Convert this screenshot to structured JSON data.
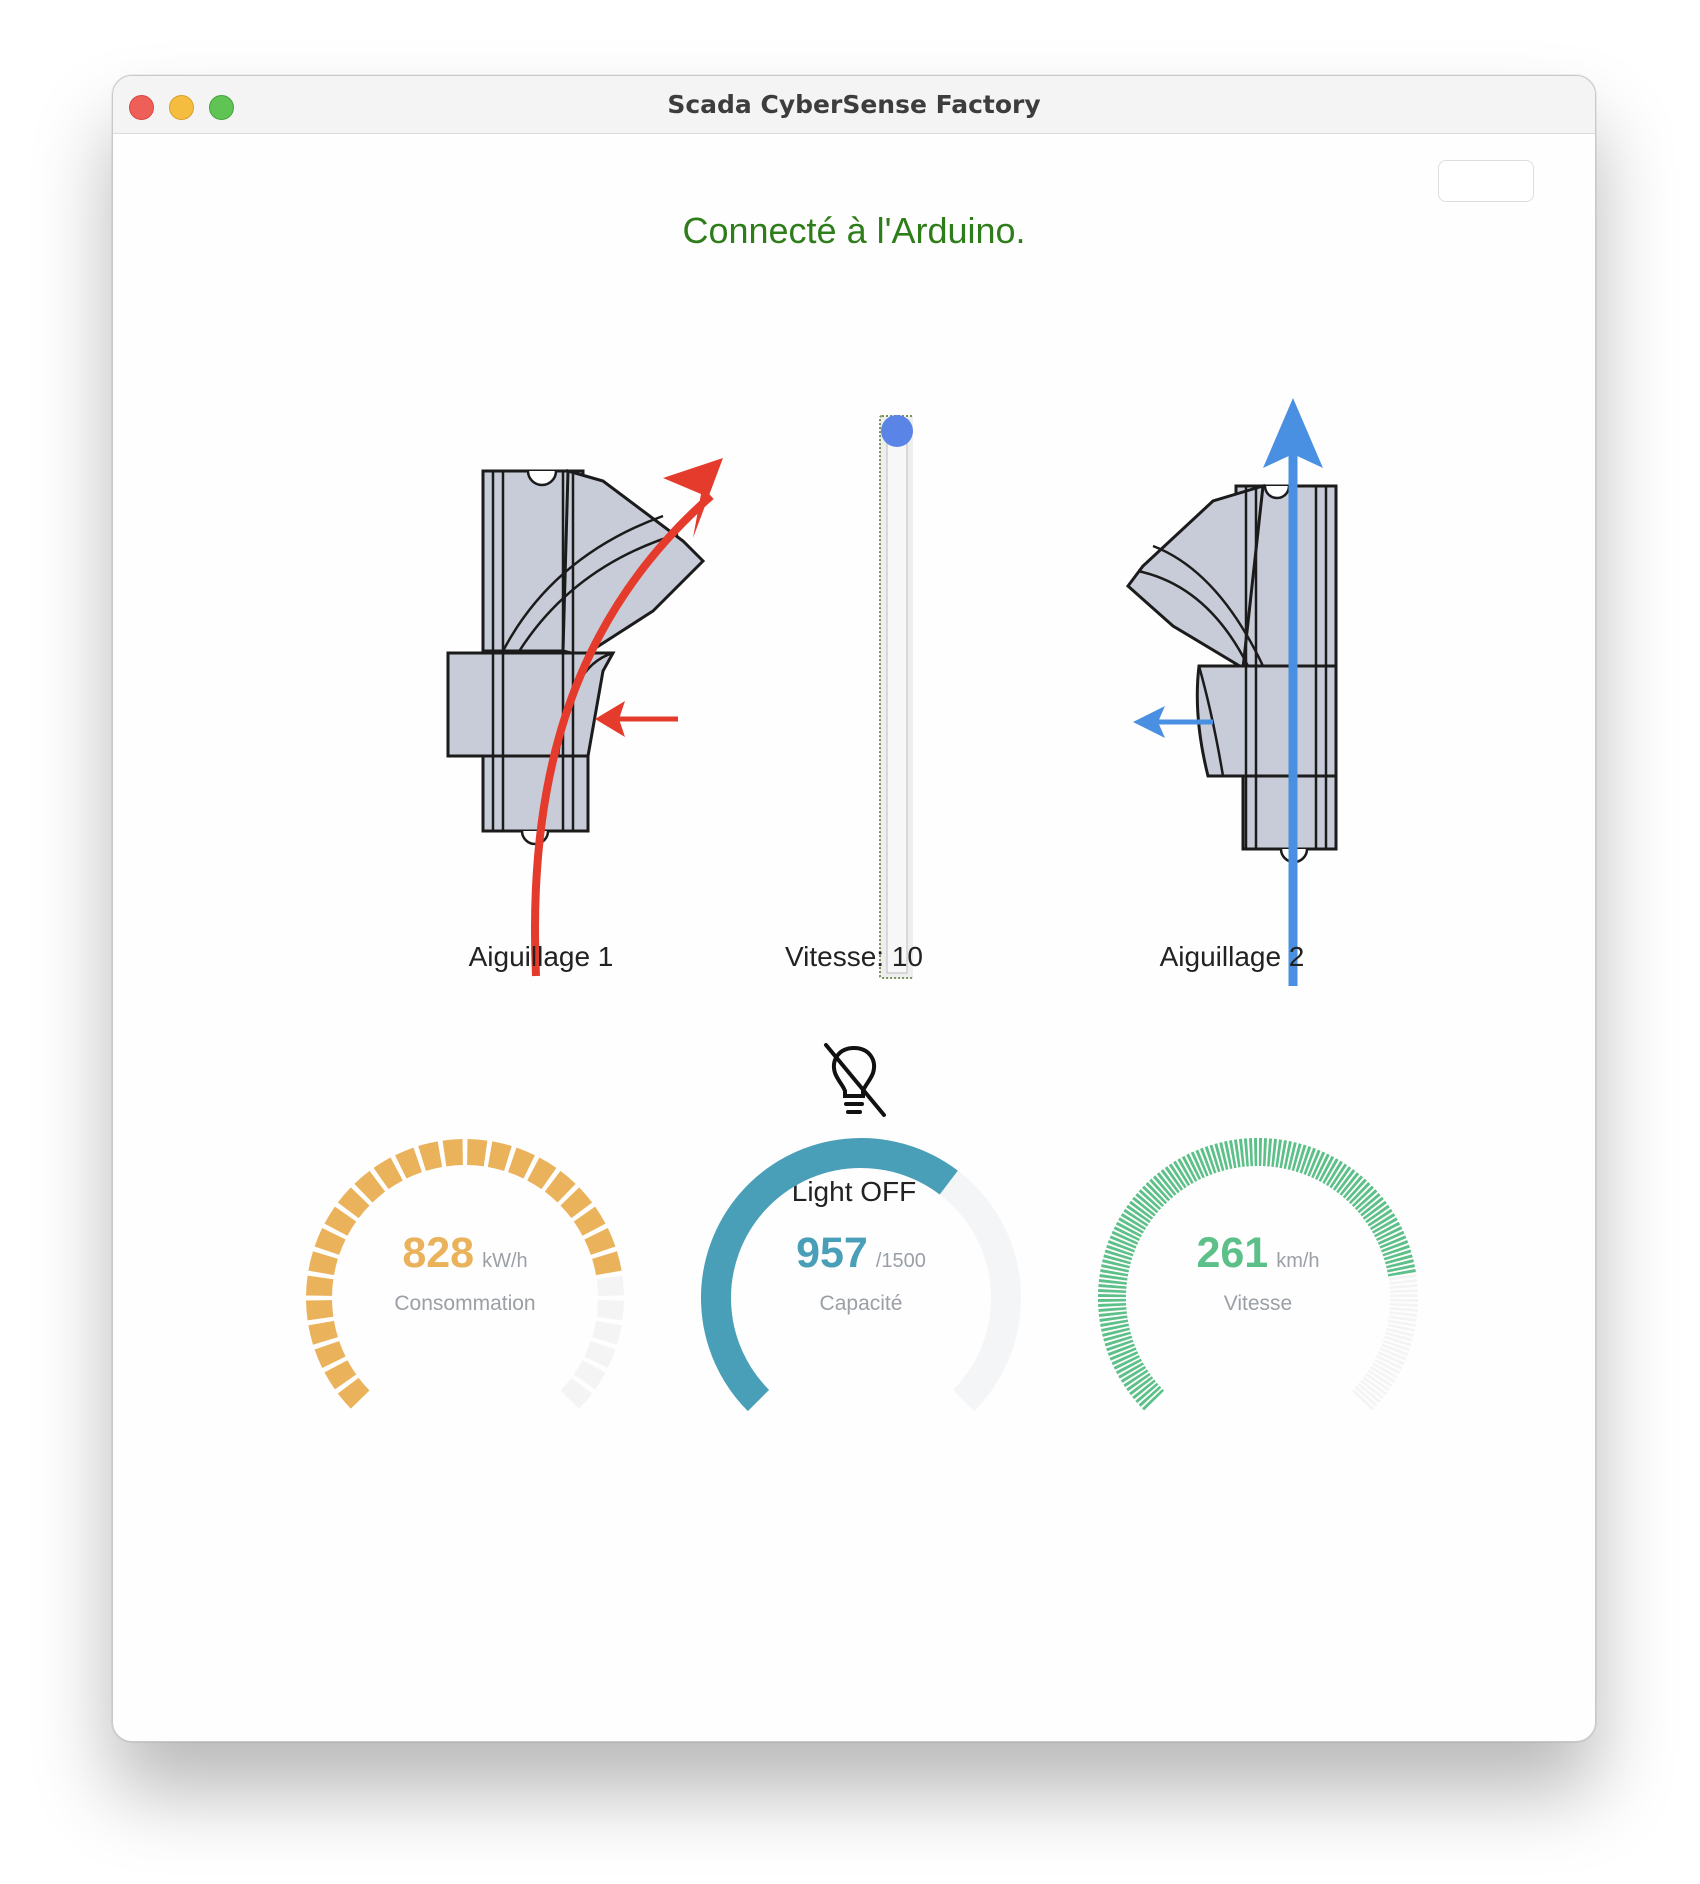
{
  "window": {
    "title": "Scada CyberSense Factory"
  },
  "status": {
    "text": "Connecté à l'Arduino.",
    "color": "#2e7d1a"
  },
  "switches": [
    {
      "label": "Aiguillage 1",
      "arrow_color": "#e53b2c",
      "direction": "diverging-right"
    },
    {
      "label": "Aiguillage 2",
      "arrow_color": "#4a90e2",
      "direction": "straight"
    }
  ],
  "speed_slider": {
    "label": "Vitesse: 10",
    "value": 10,
    "min": 0,
    "max": 10,
    "thumb_color": "#5a84e6"
  },
  "light": {
    "label": "Light OFF",
    "icon": "light-off-icon",
    "state": "off"
  },
  "gauges": [
    {
      "name": "consumption",
      "value": "828",
      "unit": "kW/h",
      "label": "Consommation",
      "fraction": 0.8,
      "color": "#eab25a",
      "style": "segmented"
    },
    {
      "name": "capacity",
      "value": "957",
      "unit": "/1500",
      "label": "Capacité",
      "fraction": 0.638,
      "color": "#4a9fb8",
      "style": "solid"
    },
    {
      "name": "speed",
      "value": "261",
      "unit": "km/h",
      "label": "Vitesse",
      "fraction": 0.8,
      "color": "#5cc088",
      "style": "fine-ticks"
    }
  ]
}
